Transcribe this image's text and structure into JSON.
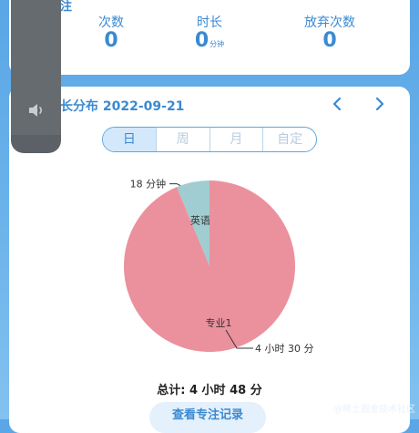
{
  "stats": {
    "title_fragment": "注",
    "items": [
      {
        "label": "次数",
        "value": "0",
        "unit": ""
      },
      {
        "label": "时长",
        "value": "0",
        "unit": "分钟"
      },
      {
        "label": "放弃次数",
        "value": "0",
        "unit": ""
      }
    ]
  },
  "distribution": {
    "title": "长分布 2022-09-21",
    "prev_icon": "chevron-left-icon",
    "next_icon": "chevron-right-icon",
    "tabs": [
      {
        "label": "日",
        "active": true
      },
      {
        "label": "周",
        "active": false
      },
      {
        "label": "月",
        "active": false
      },
      {
        "label": "自定",
        "active": false
      }
    ],
    "total_text": "总计: 4 小时 48 分",
    "record_button": "查看专注记录"
  },
  "chart_data": {
    "type": "pie",
    "series": [
      {
        "name": "英语",
        "value": 18,
        "value_label": "18 分钟",
        "color": "#9fcdd1"
      },
      {
        "name": "专业1",
        "value": 270,
        "value_label": "4 小时 30 分",
        "color": "#eb919d"
      }
    ]
  },
  "volume_hud": {
    "icon": "speaker-icon"
  },
  "watermark": "@稀土掘金技术社区",
  "colors": {
    "accent": "#3a8ad2",
    "background": "#5aa6e6"
  }
}
